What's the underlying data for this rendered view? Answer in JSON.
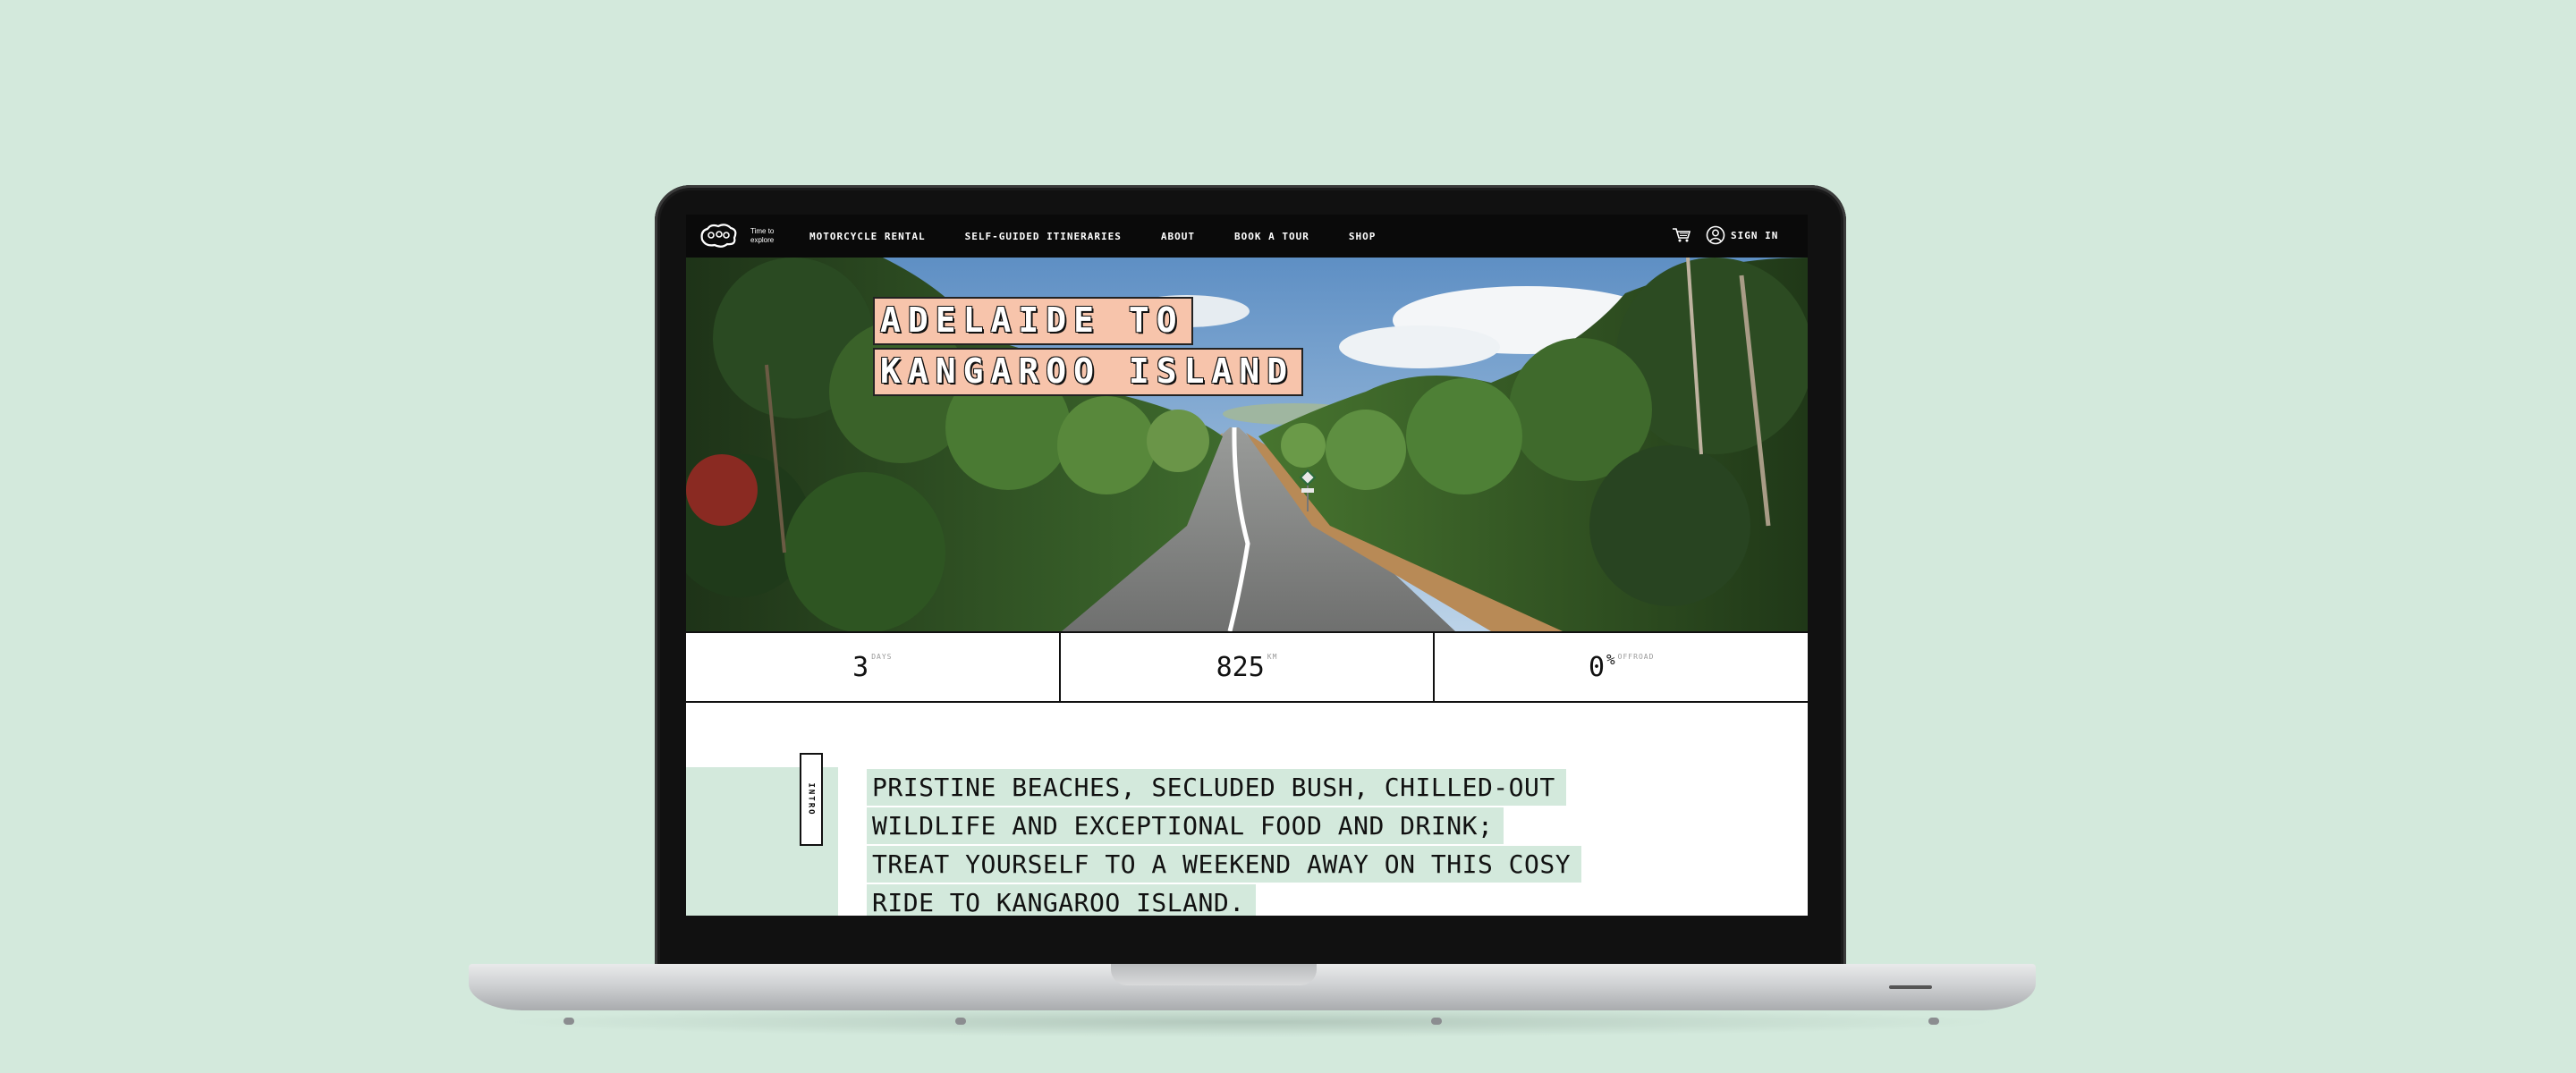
{
  "nav": {
    "tagline": "Time to explore",
    "links": [
      "MOTORCYCLE RENTAL",
      "SELF-GUIDED ITINERARIES",
      "ABOUT",
      "BOOK A TOUR",
      "SHOP"
    ],
    "sign_in": "SIGN IN"
  },
  "hero": {
    "title_line1": "ADELAIDE TO",
    "title_line2": "KANGAROO ISLAND"
  },
  "stats": [
    {
      "value": "3",
      "unit": "DAYS"
    },
    {
      "value": "825",
      "unit": "KM"
    },
    {
      "value": "0",
      "pct": "%",
      "unit": "OFFROAD"
    }
  ],
  "intro": {
    "tag": "INTRO",
    "lines": [
      "PRISTINE BEACHES, SECLUDED BUSH, CHILLED-OUT",
      "WILDLIFE AND EXCEPTIONAL FOOD AND DRINK;",
      "TREAT YOURSELF TO A WEEKEND AWAY ON THIS COSY",
      "RIDE TO KANGAROO ISLAND."
    ]
  },
  "colors": {
    "background": "#d3e9dc",
    "title_highlight": "#f7c4ab",
    "nav_bg": "#0a0a0a"
  }
}
